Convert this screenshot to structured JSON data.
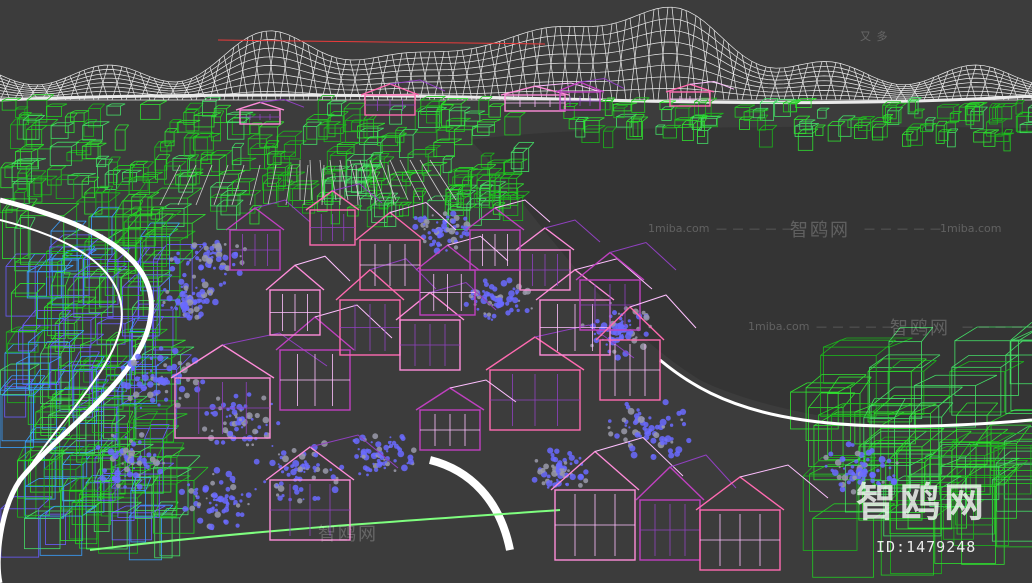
{
  "viewport": {
    "description_colors": {
      "background": "#3c3c3c",
      "terrain_wire": "#ffffff",
      "tree_wire": "#2fd42f",
      "foliage": "#6a6aff",
      "building_pink": "#ff8cd9",
      "building_magenta": "#b03aa8",
      "road": "#ffffff",
      "grass_wire": "#3ddc84"
    }
  },
  "watermark": {
    "brand": "智鸥网",
    "id_label": "ID:1479248",
    "site": "1miba.com",
    "dash": "— — — — —",
    "partial": "又 多"
  }
}
